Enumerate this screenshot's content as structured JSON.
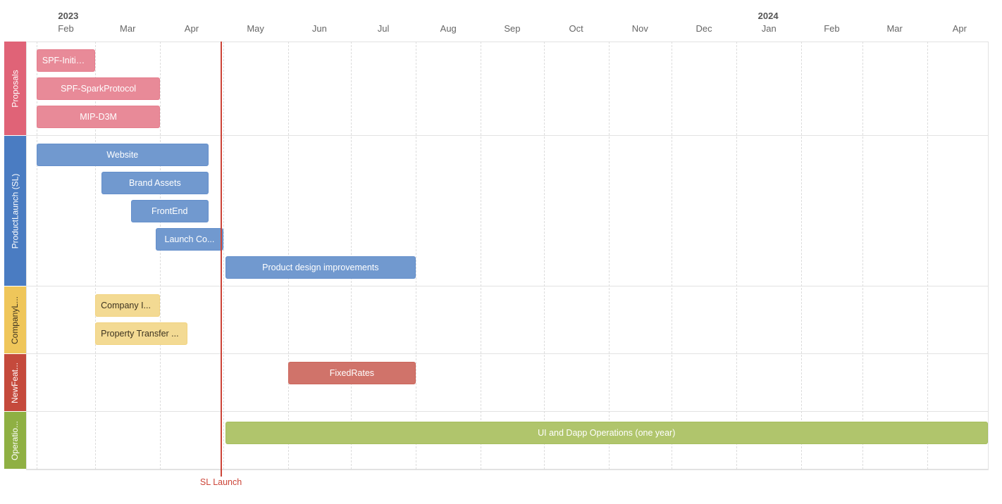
{
  "chart_data": {
    "type": "gantt",
    "title": "",
    "x_range": [
      "2023-01-27",
      "2024-04-30"
    ],
    "years": [
      {
        "label": "2023",
        "anchor": "2023-02-01"
      },
      {
        "label": "2024",
        "anchor": "2024-01-01"
      }
    ],
    "months": [
      {
        "label": "Feb",
        "start": "2023-02-01"
      },
      {
        "label": "Mar",
        "start": "2023-03-01"
      },
      {
        "label": "Apr",
        "start": "2023-04-01"
      },
      {
        "label": "May",
        "start": "2023-05-01"
      },
      {
        "label": "Jun",
        "start": "2023-06-01"
      },
      {
        "label": "Jul",
        "start": "2023-07-01"
      },
      {
        "label": "Aug",
        "start": "2023-08-01"
      },
      {
        "label": "Sep",
        "start": "2023-09-01"
      },
      {
        "label": "Oct",
        "start": "2023-10-01"
      },
      {
        "label": "Nov",
        "start": "2023-11-01"
      },
      {
        "label": "Dec",
        "start": "2023-12-01"
      },
      {
        "label": "Jan",
        "start": "2024-01-01"
      },
      {
        "label": "Feb",
        "start": "2024-02-01"
      },
      {
        "label": "Mar",
        "start": "2024-03-01"
      },
      {
        "label": "Apr",
        "start": "2024-04-01"
      }
    ],
    "grid": true,
    "lanes": [
      {
        "name": "Proposals",
        "display": "Proposals",
        "color": "#e06377",
        "bar_color": "#e88a98",
        "text_color": "#ffffff",
        "tasks": [
          {
            "label": "SPF-Initial ...",
            "start": "2023-02-01",
            "end": "2023-03-01"
          },
          {
            "label": "SPF-SparkProtocol",
            "start": "2023-02-01",
            "end": "2023-04-01"
          },
          {
            "label": "MIP-D3M",
            "start": "2023-02-01",
            "end": "2023-04-01"
          }
        ]
      },
      {
        "name": "ProductLaunch (SL)",
        "display": "ProductLaunch (SL)",
        "color": "#4a7cc2",
        "bar_color": "#7199cf",
        "text_color": "#ffffff",
        "tasks": [
          {
            "label": "Website",
            "start": "2023-02-01",
            "end": "2023-04-24"
          },
          {
            "label": "Brand Assets",
            "start": "2023-03-04",
            "end": "2023-04-24"
          },
          {
            "label": "FrontEnd",
            "start": "2023-03-18",
            "end": "2023-04-24"
          },
          {
            "label": "Launch Co...",
            "start": "2023-03-30",
            "end": "2023-05-01"
          },
          {
            "label": "Product design improvements",
            "start": "2023-05-02",
            "end": "2023-08-01"
          }
        ]
      },
      {
        "name": "CompanyL...",
        "display": "CompanyL...",
        "color": "#efc65a",
        "bar_color": "#f3da93",
        "text_color": "#3d3320",
        "tasks": [
          {
            "label": "Company I...",
            "start": "2023-03-01",
            "end": "2023-04-01"
          },
          {
            "label": "Property Transfer ...",
            "start": "2023-03-01",
            "end": "2023-04-14"
          }
        ]
      },
      {
        "name": "NewFeat...",
        "display": "NewFeat...",
        "color": "#c54a3c",
        "bar_color": "#d0736a",
        "text_color": "#ffffff",
        "tasks": [
          {
            "label": "FixedRates",
            "start": "2023-06-01",
            "end": "2023-08-01"
          }
        ]
      },
      {
        "name": "Operatio...",
        "display": "Operatio...",
        "color": "#8fb043",
        "bar_color": "#b0c56c",
        "text_color": "#ffffff",
        "tasks": [
          {
            "label": "UI and Dapp Operations (one year)",
            "start": "2023-05-02",
            "end": "2024-04-30"
          }
        ]
      }
    ],
    "markers": [
      {
        "label": "SL Launch",
        "date": "2023-04-30",
        "color": "#cc4437"
      }
    ]
  }
}
